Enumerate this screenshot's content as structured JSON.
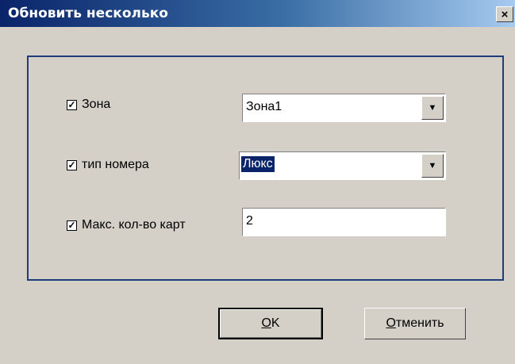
{
  "window": {
    "title": "Обновить несколько",
    "close_glyph": "×"
  },
  "rows": [
    {
      "label": "Зона",
      "checked": true,
      "control": "dropdown",
      "value": "Зона1"
    },
    {
      "label": "тип номера",
      "checked": true,
      "control": "dropdown",
      "value": "Люкс"
    },
    {
      "label": "Макс. кол-во карт",
      "checked": true,
      "control": "text",
      "value": "2"
    }
  ],
  "buttons": {
    "ok_hotkey": "O",
    "ok_rest": "K",
    "cancel_hotkey": "О",
    "cancel_rest": "тменить"
  }
}
